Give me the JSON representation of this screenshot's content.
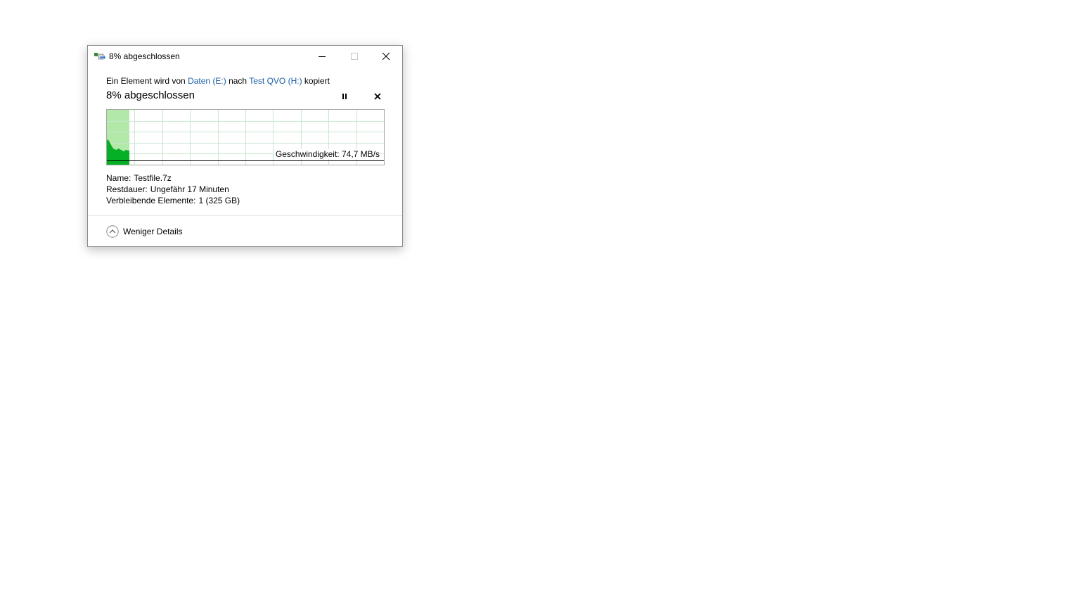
{
  "window": {
    "title": "8% abgeschlossen"
  },
  "copy": {
    "prefix": "Ein Element wird von ",
    "source": "Daten (E:)",
    "middle": " nach ",
    "destination": "Test QVO (H:)",
    "suffix": " kopiert",
    "percent_label": "8% abgeschlossen",
    "progress_fraction": 0.08
  },
  "graph": {
    "speed_label": "Geschwindigkeit: 74,7 MB/s",
    "fill_color": "#5fd05f",
    "area_color": "#06b025",
    "progress_color": "#b2e8a8",
    "grid_color": "#c7e7d1"
  },
  "details": {
    "name_label": "Name:",
    "name_value": "Testfile.7z",
    "remaining_label": "Restdauer:",
    "remaining_value": "Ungefähr 17 Minuten",
    "items_label": "Verbleibende Elemente:",
    "items_value": "1 (325 GB)"
  },
  "footer": {
    "toggle_label": "Weniger Details"
  },
  "icons": {
    "app": "copy-files-icon",
    "minimize": "minimize-icon",
    "maximize": "maximize-icon",
    "close": "close-icon",
    "pause": "pause-icon",
    "cancel": "cancel-icon",
    "chevron": "chevron-up-icon"
  }
}
